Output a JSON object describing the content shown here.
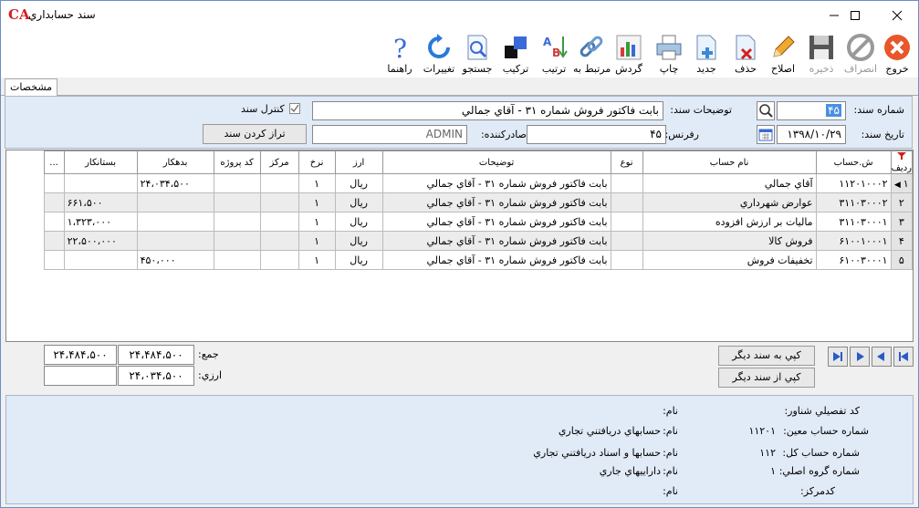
{
  "window": {
    "title": "سند حسابداري",
    "logo": "CA"
  },
  "toolbar": [
    {
      "label": "خروج",
      "icon": "exit-icon",
      "enabled": true
    },
    {
      "label": "انصراف",
      "icon": "cancel-icon",
      "enabled": false
    },
    {
      "label": "ذخيره",
      "icon": "save-icon",
      "enabled": false
    },
    {
      "label": "اصلاح",
      "icon": "edit-pencil-icon",
      "enabled": true
    },
    {
      "label": "حذف",
      "icon": "delete-doc-icon",
      "enabled": true
    },
    {
      "label": "جديد",
      "icon": "new-doc-icon",
      "enabled": true
    },
    {
      "label": "چاپ",
      "icon": "printer-icon",
      "enabled": true
    },
    {
      "label": "گردش",
      "icon": "chart-icon",
      "enabled": true
    },
    {
      "label": "مرتبط به",
      "icon": "link-icon",
      "enabled": true
    },
    {
      "label": "ترتيب",
      "icon": "sort-icon",
      "enabled": true
    },
    {
      "label": "تركيب",
      "icon": "combine-icon",
      "enabled": true
    },
    {
      "label": "جستجو",
      "icon": "search-doc-icon",
      "enabled": true
    },
    {
      "label": "تغييرات",
      "icon": "refresh-icon",
      "enabled": true
    },
    {
      "label": "راهنما",
      "icon": "help-icon",
      "enabled": true
    }
  ],
  "tab": "مشخصات",
  "header": {
    "doc_no_label": "شماره سند:",
    "doc_no": "۴۵",
    "desc_label": "توضيحات سند:",
    "desc": "بابت فاکتور فروش شماره ۳۱ - آقاي جمالي",
    "control_label": "كنترل سند",
    "control_checked": true,
    "date_label": "تاريخ سند:",
    "date": "۱۳۹۸/۱۰/۲۹",
    "ref_label": "رفرنس:",
    "ref": "۴۵",
    "issuer_label": "صادركننده:",
    "issuer": "ADMIN",
    "balance_button": "تراز كردن سند"
  },
  "grid": {
    "columns": [
      "رديف",
      "ش.حساب",
      "نام حساب",
      "نوع",
      "توضيحات",
      "ارز",
      "نرخ",
      "مركز",
      "كد پروژه",
      "بدهكار",
      "بستانكار",
      "..."
    ],
    "rows": [
      {
        "n": "۱",
        "acc": "۱۱۲۰۱۰۰۰۲",
        "name": "آقاي جمالي",
        "type": "",
        "desc": "بابت فاکتور فروش شماره ۳۱ - آقاي جمالي",
        "cur": "ريال",
        "rate": "۱",
        "center": "",
        "proj": "",
        "debit": "۲۴،۰۳۴،۵۰۰",
        "credit": ""
      },
      {
        "n": "۲",
        "acc": "۳۱۱۰۳۰۰۰۲",
        "name": "عوارض شهرداري",
        "type": "",
        "desc": "بابت فاکتور فروش شماره ۳۱ - آقاي جمالي",
        "cur": "ريال",
        "rate": "۱",
        "center": "",
        "proj": "",
        "debit": "",
        "credit": "۶۶۱،۵۰۰"
      },
      {
        "n": "۳",
        "acc": "۳۱۱۰۳۰۰۰۱",
        "name": "ماليات بر ارزش افزوده",
        "type": "",
        "desc": "بابت فاکتور فروش شماره ۳۱ - آقاي جمالي",
        "cur": "ريال",
        "rate": "۱",
        "center": "",
        "proj": "",
        "debit": "",
        "credit": "۱،۳۲۳،۰۰۰"
      },
      {
        "n": "۴",
        "acc": "۶۱۰۰۱۰۰۰۱",
        "name": "فروش كالا",
        "type": "",
        "desc": "بابت فاکتور فروش شماره ۳۱ - آقاي جمالي",
        "cur": "ريال",
        "rate": "۱",
        "center": "",
        "proj": "",
        "debit": "",
        "credit": "۲۲،۵۰۰،۰۰۰"
      },
      {
        "n": "۵",
        "acc": "۶۱۰۰۳۰۰۰۱",
        "name": "تخفيفات فروش",
        "type": "",
        "desc": "بابت فاکتور فروش شماره ۳۱ - آقاي جمالي",
        "cur": "ريال",
        "rate": "۱",
        "center": "",
        "proj": "",
        "debit": "۴۵۰،۰۰۰",
        "credit": ""
      }
    ]
  },
  "totals": {
    "sum_label": "جمع:",
    "sum_debit": "۲۴،۴۸۴،۵۰۰",
    "sum_credit": "۲۴،۴۸۴،۵۰۰",
    "fx_label": "ارزي:",
    "fx_debit": "۲۴،۰۳۴،۵۰۰",
    "fx_credit": "",
    "copy_to": "كپي به سند ديگر",
    "copy_from": "كپي از سند ديگر"
  },
  "footer": {
    "detail_label": "كد تفصيلي شناور:",
    "detail_value": "",
    "detail_name_label": "نام:",
    "detail_name": "",
    "moein_label": "شماره حساب معين:",
    "moein_value": "۱۱۲۰۱",
    "moein_name_label": "نام:",
    "moein_name": "حسابهاي دريافتني تجاري",
    "kol_label": "شماره حساب كل:",
    "kol_value": "۱۱۲",
    "kol_name_label": "نام:",
    "kol_name": "حسابها و اسناد دريافتني تجاري",
    "group_label": "شماره گروه اصلي:",
    "group_value": "۱",
    "group_name_label": "نام:",
    "group_name": "داراييهاي جاري",
    "center_label": "كدمركز:",
    "center_value": "",
    "center_name_label": "نام:",
    "center_name": ""
  },
  "colors": {
    "panel": "#e1eaf7",
    "selected_cell": "#4a90e2"
  }
}
